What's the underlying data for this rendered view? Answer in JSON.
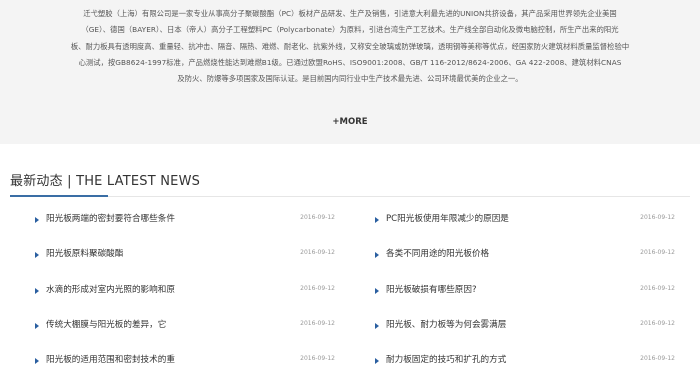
{
  "about": {
    "lines": [
      "迁弋塑胶（上海）有限公司是一家专业从事高分子聚碳酸酯（PC）板材产品研发、生产及销售，引进意大利最先进的UNION共挤设备，其产品采用世界领先企业美国",
      "（GE）、德国（BAYER）、日本（帝人）高分子工程塑料PC（Polycarbonate）为原料，引进台湾生产工艺技术。生产线全部自动化及微电脑控制，所生产出来的阳光",
      "板、耐力板具有透明度高、重量轻、抗冲击、隔音、隔热、难燃、耐老化、抗紫外线，又称安全玻璃或防弹玻璃，透明钢等美称等优点，经国家防火建筑材料质量监督检验中",
      "心测试，按GB8624-1997标准，产品燃烧性能达到难燃B1级。已通过欧盟RoHS、ISO9001:2008、GB/T 116-2012/8624-2006、GA 422-2008、建筑材料CNAS",
      "及防火、防爆等多项国家及国际认证。是目前国内同行业中生产技术最先进、公司环境最优美的企业之一。"
    ],
    "more_label": "+MORE"
  },
  "news": {
    "heading_zh": "最新动态",
    "heading_sep": " | ",
    "heading_en": "THE LATEST NEWS",
    "left": [
      {
        "title": "阳光板两端的密封要符合哪些条件",
        "date": "2016-09-12"
      },
      {
        "title": "阳光板原料聚碳酸酯",
        "date": "2016-09-12"
      },
      {
        "title": "水滴的形成对室内光照的影响和原",
        "date": "2016-09-12"
      },
      {
        "title": "传统大棚膜与阳光板的差异，它",
        "date": "2016-09-12"
      },
      {
        "title": "阳光板的适用范围和密封技术的重",
        "date": "2016-09-12"
      }
    ],
    "right": [
      {
        "title": "PC阳光板使用年限减少的原因是",
        "date": "2016-09-12"
      },
      {
        "title": "各类不同用途的阳光板价格",
        "date": "2016-09-12"
      },
      {
        "title": "阳光板破损有哪些原因?",
        "date": "2016-09-12"
      },
      {
        "title": "阳光板、耐力板等为何会雾满层",
        "date": "2016-09-12"
      },
      {
        "title": "耐力板固定的技巧和扩孔的方式",
        "date": "2016-09-12"
      }
    ]
  },
  "colors": {
    "accent": "#3a6ea5",
    "bullet": "#2a5fa0",
    "page_bg": "#f4f4f4"
  }
}
